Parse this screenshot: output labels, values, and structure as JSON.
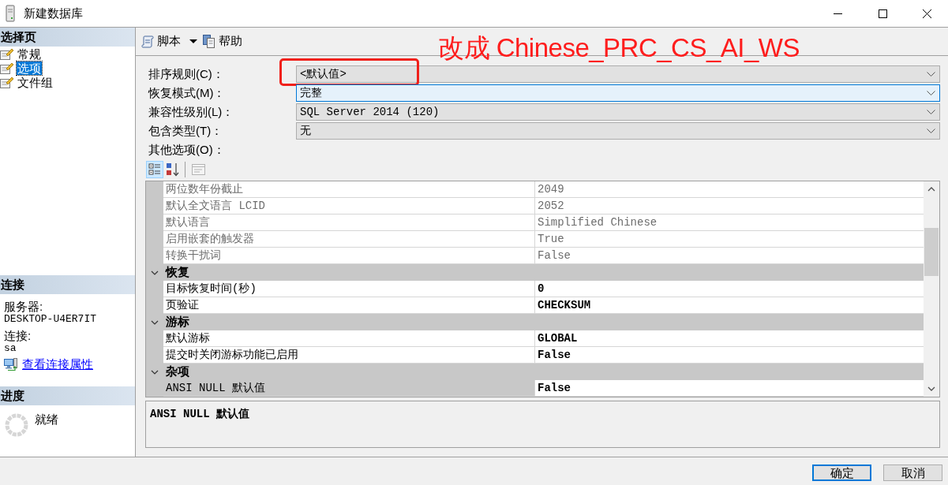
{
  "window": {
    "title": "新建数据库"
  },
  "annotation": {
    "text": "改成 Chinese_PRC_CS_AI_WS"
  },
  "sidebar": {
    "pages_header": "选择页",
    "pages": [
      {
        "label": "常规",
        "selected": false
      },
      {
        "label": "选项",
        "selected": true
      },
      {
        "label": "文件组",
        "selected": false
      }
    ],
    "connection": {
      "header": "连接",
      "server_label": "服务器:",
      "server": "DESKTOP-U4ER7IT",
      "login_label": "连接:",
      "login": "sa",
      "link": "查看连接属性"
    },
    "progress": {
      "header": "进度",
      "status": "就绪"
    }
  },
  "toolbar": {
    "script": "脚本",
    "help": "帮助"
  },
  "options": [
    {
      "label": "排序规则(C)：",
      "value": "<默认值>",
      "focused": false,
      "marked": true
    },
    {
      "label": "恢复模式(M)：",
      "value": "完整",
      "focused": true,
      "marked": false
    },
    {
      "label": "兼容性级别(L)：",
      "value": "SQL Server 2014 (120)",
      "focused": false,
      "marked": false
    },
    {
      "label": "包含类型(T)：",
      "value": "无",
      "focused": false,
      "marked": false
    }
  ],
  "other_options": {
    "label": "其他选项(O)：",
    "view_buttons": [
      {
        "kind": "categorized",
        "selected": true,
        "disabled": false
      },
      {
        "kind": "alphabetical",
        "selected": false,
        "disabled": false
      },
      {
        "kind": "property_pages",
        "selected": false,
        "disabled": true
      }
    ],
    "categories": [
      {
        "properties": [
          {
            "name": "两位数年份截止",
            "value": "2049",
            "disabled": true,
            "selected": false
          },
          {
            "name": "默认全文语言 LCID",
            "value": "2052",
            "disabled": true,
            "selected": false
          },
          {
            "name": "默认语言",
            "value": "Simplified Chinese",
            "disabled": true,
            "selected": false
          },
          {
            "name": "启用嵌套的触发器",
            "value": "True",
            "disabled": true,
            "selected": false
          },
          {
            "name": "转换干扰词",
            "value": "False",
            "disabled": true,
            "selected": false
          }
        ]
      },
      {
        "name": "恢复",
        "expanded": true,
        "properties": [
          {
            "name": "目标恢复时间(秒)",
            "value": "0",
            "disabled": false,
            "selected": false
          },
          {
            "name": "页验证",
            "value": "CHECKSUM",
            "disabled": false,
            "selected": false
          }
        ]
      },
      {
        "name": "游标",
        "expanded": true,
        "properties": [
          {
            "name": "默认游标",
            "value": "GLOBAL",
            "disabled": false,
            "selected": false
          },
          {
            "name": "提交时关闭游标功能已启用",
            "value": "False",
            "disabled": false,
            "selected": false
          }
        ]
      },
      {
        "name": "杂项",
        "expanded": true,
        "properties": [
          {
            "name": "ANSI NULL 默认值",
            "value": "False",
            "disabled": false,
            "selected": true
          }
        ]
      }
    ],
    "description": {
      "title": "ANSI NULL 默认值"
    }
  },
  "buttons": [
    {
      "label": "确定",
      "focused": true
    },
    {
      "label": "取消",
      "focused": false
    }
  ]
}
